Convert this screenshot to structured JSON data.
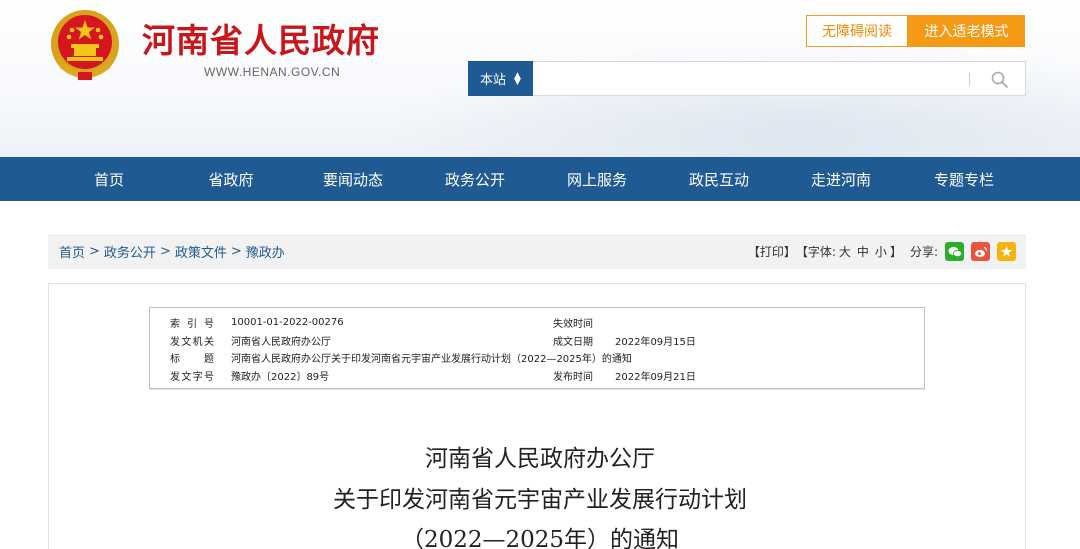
{
  "header": {
    "site_title": "河南省人民政府",
    "site_url": "WWW.HENAN.GOV.CN",
    "accessibility_label": "无障碍阅读",
    "elder_mode_label": "进入适老模式",
    "search_scope": "本站",
    "search_value": ""
  },
  "nav": {
    "items": [
      "首页",
      "省政府",
      "要闻动态",
      "政务公开",
      "网上服务",
      "政民互动",
      "走进河南",
      "专题专栏"
    ]
  },
  "breadcrumb": {
    "items": [
      "首页",
      "政务公开",
      "政策文件",
      "豫政办"
    ],
    "sep": ">"
  },
  "tools": {
    "print": "【打印】",
    "font_label": "【字体:",
    "font_large": "大",
    "font_medium": "中",
    "font_small": "小",
    "font_end": "】",
    "share_label": "分享:"
  },
  "meta": {
    "index_label": "索引号",
    "index_value": "10001-01-2022-00276",
    "invalid_label": "失效时间",
    "invalid_value": "",
    "issuer_label": "发文机关",
    "issuer_value": "河南省人民政府办公厅",
    "created_label": "成文日期",
    "created_value": "2022年09月15日",
    "title_label": "标题",
    "title_value": "河南省人民政府办公厅关于印发河南省元宇宙产业发展行动计划（2022—2025年）的通知",
    "docno_label": "发文字号",
    "docno_value": "豫政办〔2022〕89号",
    "published_label": "发布时间",
    "published_value": "2022年09月21日"
  },
  "document": {
    "title_line1": "河南省人民政府办公厅",
    "title_line2": "关于印发河南省元宇宙产业发展行动计划",
    "title_line3": "（2022—2025年）的通知"
  },
  "colors": {
    "brand_red": "#c8161d",
    "nav_blue": "#1f5a92",
    "accent_orange": "#f59a14"
  }
}
